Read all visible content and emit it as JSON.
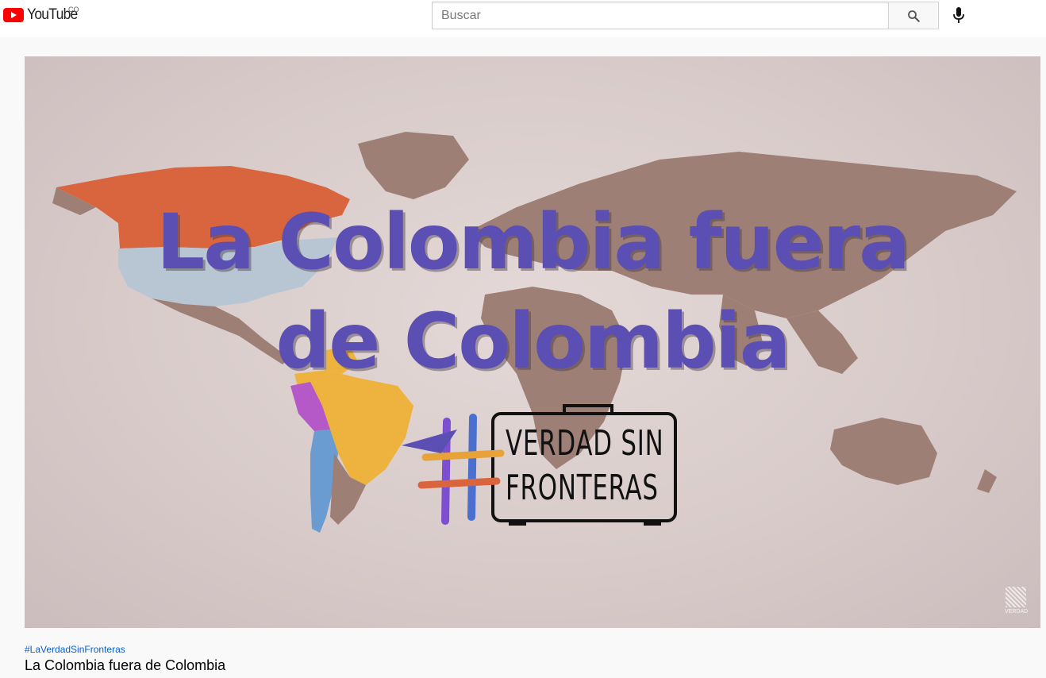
{
  "header": {
    "logo_text": "YouTube",
    "country_code": "CO",
    "search_placeholder": "Buscar",
    "search_icon": "search-icon",
    "mic_icon": "microphone-icon"
  },
  "video": {
    "thumbnail_title_line1": "La Colombia fuera",
    "thumbnail_title_line2": "de Colombia",
    "brand_line1": "VERDAD SIN",
    "brand_line2": "FRONTERAS",
    "watermark_text": "VERDAD",
    "accent_color": "#5b4fb3"
  },
  "info": {
    "hashtag": "#LaVerdadSinFronteras",
    "title": "La Colombia fuera de Colombia"
  }
}
